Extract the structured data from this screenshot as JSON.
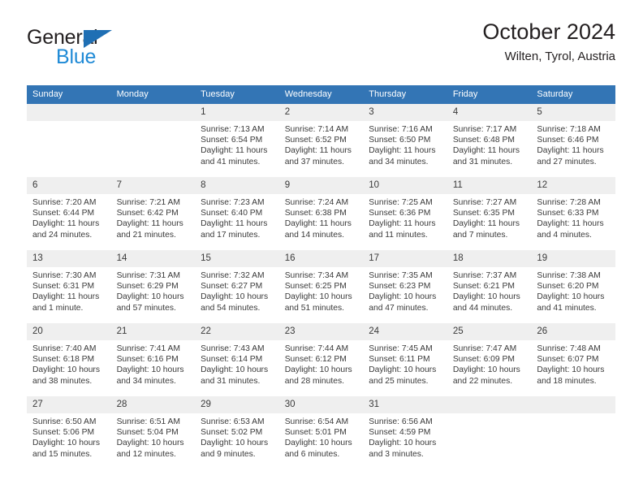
{
  "brand": {
    "name_part1": "General",
    "name_part2": "Blue",
    "triangle_icon": "triangle-logo-icon"
  },
  "header": {
    "title": "October 2024",
    "location": "Wilten, Tyrol, Austria"
  },
  "calendar": {
    "weekday_headers": [
      "Sunday",
      "Monday",
      "Tuesday",
      "Wednesday",
      "Thursday",
      "Friday",
      "Saturday"
    ],
    "accent_color": "#3375b5",
    "row_divider_color": "#2c6fae",
    "daynum_bg": "#efefef",
    "weeks": [
      [
        {
          "day": "",
          "sunrise": "",
          "sunset": "",
          "daylight1": "",
          "daylight2": ""
        },
        {
          "day": "",
          "sunrise": "",
          "sunset": "",
          "daylight1": "",
          "daylight2": ""
        },
        {
          "day": "1",
          "sunrise": "Sunrise: 7:13 AM",
          "sunset": "Sunset: 6:54 PM",
          "daylight1": "Daylight: 11 hours",
          "daylight2": "and 41 minutes."
        },
        {
          "day": "2",
          "sunrise": "Sunrise: 7:14 AM",
          "sunset": "Sunset: 6:52 PM",
          "daylight1": "Daylight: 11 hours",
          "daylight2": "and 37 minutes."
        },
        {
          "day": "3",
          "sunrise": "Sunrise: 7:16 AM",
          "sunset": "Sunset: 6:50 PM",
          "daylight1": "Daylight: 11 hours",
          "daylight2": "and 34 minutes."
        },
        {
          "day": "4",
          "sunrise": "Sunrise: 7:17 AM",
          "sunset": "Sunset: 6:48 PM",
          "daylight1": "Daylight: 11 hours",
          "daylight2": "and 31 minutes."
        },
        {
          "day": "5",
          "sunrise": "Sunrise: 7:18 AM",
          "sunset": "Sunset: 6:46 PM",
          "daylight1": "Daylight: 11 hours",
          "daylight2": "and 27 minutes."
        }
      ],
      [
        {
          "day": "6",
          "sunrise": "Sunrise: 7:20 AM",
          "sunset": "Sunset: 6:44 PM",
          "daylight1": "Daylight: 11 hours",
          "daylight2": "and 24 minutes."
        },
        {
          "day": "7",
          "sunrise": "Sunrise: 7:21 AM",
          "sunset": "Sunset: 6:42 PM",
          "daylight1": "Daylight: 11 hours",
          "daylight2": "and 21 minutes."
        },
        {
          "day": "8",
          "sunrise": "Sunrise: 7:23 AM",
          "sunset": "Sunset: 6:40 PM",
          "daylight1": "Daylight: 11 hours",
          "daylight2": "and 17 minutes."
        },
        {
          "day": "9",
          "sunrise": "Sunrise: 7:24 AM",
          "sunset": "Sunset: 6:38 PM",
          "daylight1": "Daylight: 11 hours",
          "daylight2": "and 14 minutes."
        },
        {
          "day": "10",
          "sunrise": "Sunrise: 7:25 AM",
          "sunset": "Sunset: 6:36 PM",
          "daylight1": "Daylight: 11 hours",
          "daylight2": "and 11 minutes."
        },
        {
          "day": "11",
          "sunrise": "Sunrise: 7:27 AM",
          "sunset": "Sunset: 6:35 PM",
          "daylight1": "Daylight: 11 hours",
          "daylight2": "and 7 minutes."
        },
        {
          "day": "12",
          "sunrise": "Sunrise: 7:28 AM",
          "sunset": "Sunset: 6:33 PM",
          "daylight1": "Daylight: 11 hours",
          "daylight2": "and 4 minutes."
        }
      ],
      [
        {
          "day": "13",
          "sunrise": "Sunrise: 7:30 AM",
          "sunset": "Sunset: 6:31 PM",
          "daylight1": "Daylight: 11 hours",
          "daylight2": "and 1 minute."
        },
        {
          "day": "14",
          "sunrise": "Sunrise: 7:31 AM",
          "sunset": "Sunset: 6:29 PM",
          "daylight1": "Daylight: 10 hours",
          "daylight2": "and 57 minutes."
        },
        {
          "day": "15",
          "sunrise": "Sunrise: 7:32 AM",
          "sunset": "Sunset: 6:27 PM",
          "daylight1": "Daylight: 10 hours",
          "daylight2": "and 54 minutes."
        },
        {
          "day": "16",
          "sunrise": "Sunrise: 7:34 AM",
          "sunset": "Sunset: 6:25 PM",
          "daylight1": "Daylight: 10 hours",
          "daylight2": "and 51 minutes."
        },
        {
          "day": "17",
          "sunrise": "Sunrise: 7:35 AM",
          "sunset": "Sunset: 6:23 PM",
          "daylight1": "Daylight: 10 hours",
          "daylight2": "and 47 minutes."
        },
        {
          "day": "18",
          "sunrise": "Sunrise: 7:37 AM",
          "sunset": "Sunset: 6:21 PM",
          "daylight1": "Daylight: 10 hours",
          "daylight2": "and 44 minutes."
        },
        {
          "day": "19",
          "sunrise": "Sunrise: 7:38 AM",
          "sunset": "Sunset: 6:20 PM",
          "daylight1": "Daylight: 10 hours",
          "daylight2": "and 41 minutes."
        }
      ],
      [
        {
          "day": "20",
          "sunrise": "Sunrise: 7:40 AM",
          "sunset": "Sunset: 6:18 PM",
          "daylight1": "Daylight: 10 hours",
          "daylight2": "and 38 minutes."
        },
        {
          "day": "21",
          "sunrise": "Sunrise: 7:41 AM",
          "sunset": "Sunset: 6:16 PM",
          "daylight1": "Daylight: 10 hours",
          "daylight2": "and 34 minutes."
        },
        {
          "day": "22",
          "sunrise": "Sunrise: 7:43 AM",
          "sunset": "Sunset: 6:14 PM",
          "daylight1": "Daylight: 10 hours",
          "daylight2": "and 31 minutes."
        },
        {
          "day": "23",
          "sunrise": "Sunrise: 7:44 AM",
          "sunset": "Sunset: 6:12 PM",
          "daylight1": "Daylight: 10 hours",
          "daylight2": "and 28 minutes."
        },
        {
          "day": "24",
          "sunrise": "Sunrise: 7:45 AM",
          "sunset": "Sunset: 6:11 PM",
          "daylight1": "Daylight: 10 hours",
          "daylight2": "and 25 minutes."
        },
        {
          "day": "25",
          "sunrise": "Sunrise: 7:47 AM",
          "sunset": "Sunset: 6:09 PM",
          "daylight1": "Daylight: 10 hours",
          "daylight2": "and 22 minutes."
        },
        {
          "day": "26",
          "sunrise": "Sunrise: 7:48 AM",
          "sunset": "Sunset: 6:07 PM",
          "daylight1": "Daylight: 10 hours",
          "daylight2": "and 18 minutes."
        }
      ],
      [
        {
          "day": "27",
          "sunrise": "Sunrise: 6:50 AM",
          "sunset": "Sunset: 5:06 PM",
          "daylight1": "Daylight: 10 hours",
          "daylight2": "and 15 minutes."
        },
        {
          "day": "28",
          "sunrise": "Sunrise: 6:51 AM",
          "sunset": "Sunset: 5:04 PM",
          "daylight1": "Daylight: 10 hours",
          "daylight2": "and 12 minutes."
        },
        {
          "day": "29",
          "sunrise": "Sunrise: 6:53 AM",
          "sunset": "Sunset: 5:02 PM",
          "daylight1": "Daylight: 10 hours",
          "daylight2": "and 9 minutes."
        },
        {
          "day": "30",
          "sunrise": "Sunrise: 6:54 AM",
          "sunset": "Sunset: 5:01 PM",
          "daylight1": "Daylight: 10 hours",
          "daylight2": "and 6 minutes."
        },
        {
          "day": "31",
          "sunrise": "Sunrise: 6:56 AM",
          "sunset": "Sunset: 4:59 PM",
          "daylight1": "Daylight: 10 hours",
          "daylight2": "and 3 minutes."
        },
        {
          "day": "",
          "sunrise": "",
          "sunset": "",
          "daylight1": "",
          "daylight2": ""
        },
        {
          "day": "",
          "sunrise": "",
          "sunset": "",
          "daylight1": "",
          "daylight2": ""
        }
      ]
    ]
  }
}
